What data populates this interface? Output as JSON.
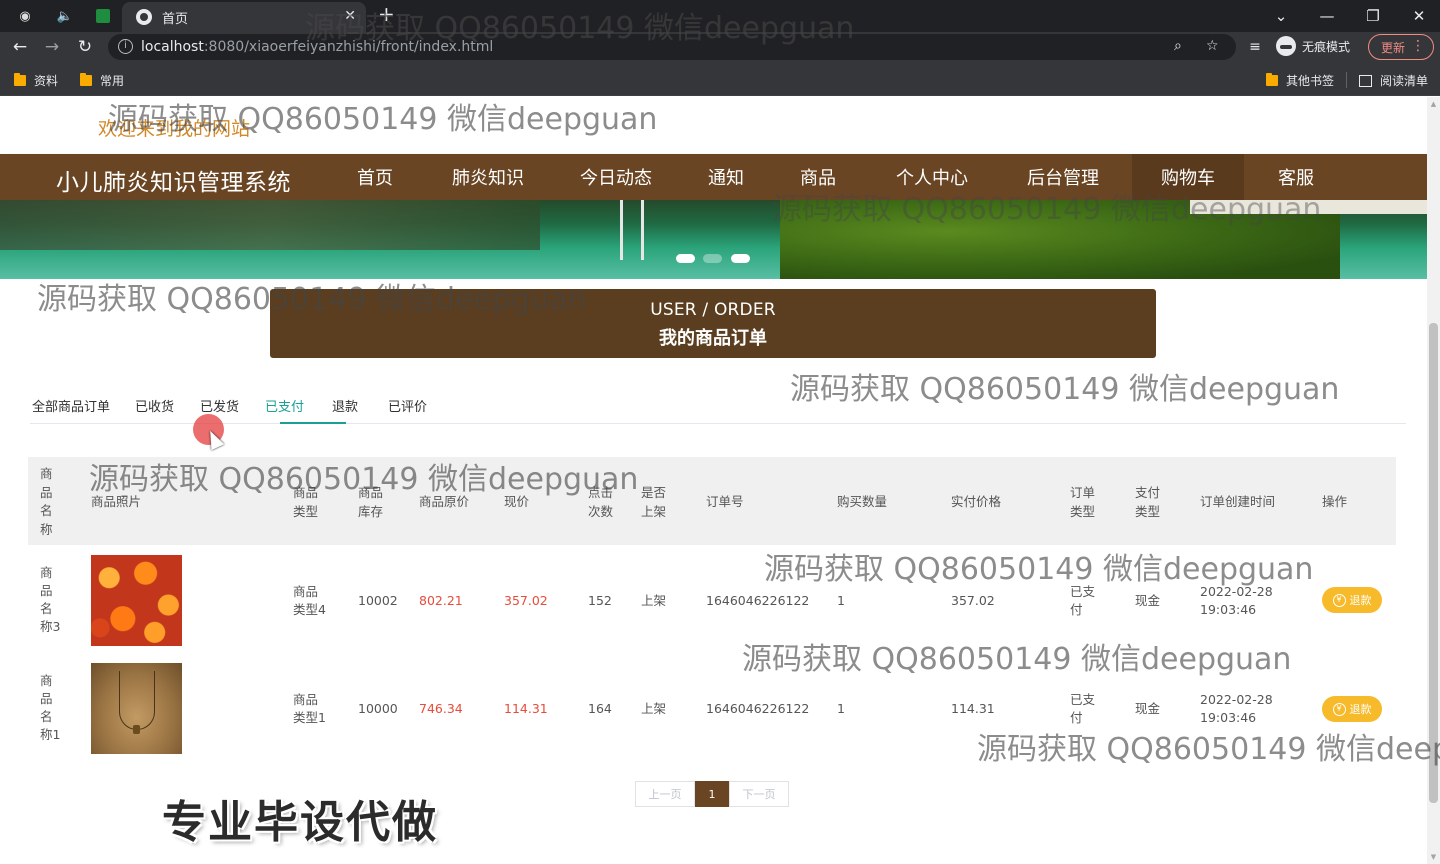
{
  "browser": {
    "tab_title": "首页",
    "url_host": "localhost",
    "url_path": ":8080/xiaoerfeiyanzhishi/front/index.html",
    "incognito_label": "无痕模式",
    "update_label": "更新",
    "bookmarks": [
      "资料",
      "常用"
    ],
    "bookmarks_right": [
      "其他书签",
      "阅读清单"
    ]
  },
  "site": {
    "welcome": "欢迎来到我的网站",
    "brand": "小儿肺炎知识管理系统",
    "nav": [
      "首页",
      "肺炎知识",
      "今日动态",
      "通知",
      "商品",
      "个人中心",
      "后台管理",
      "购物车",
      "客服"
    ],
    "active_nav": "购物车"
  },
  "order_banner": {
    "en": "USER / ORDER",
    "cn": "我的商品订单"
  },
  "order_tabs": {
    "items": [
      "全部商品订单",
      "已收货",
      "已发货",
      "已支付",
      "退款",
      "已评价"
    ],
    "active": "已支付"
  },
  "table": {
    "headers": {
      "name": "商\n品\n名\n称",
      "image": "商品照片",
      "type": "商品\n类型",
      "stock": "商品\n库存",
      "price": "商品原价",
      "current": "现价",
      "clicks": "点击\n次数",
      "onshelf": "是否\n上架",
      "order_no": "订单号",
      "qty": "购买数量",
      "paid": "实付价格",
      "order_type": "订单\n类型",
      "pay_type": "支付\n类型",
      "created": "订单创建时间",
      "action": "操作"
    },
    "rows": [
      {
        "name": "商\n品\n名\n称3",
        "image": "flowers",
        "type": "商品\n类型4",
        "stock": "10002",
        "price": "802.21",
        "current": "357.02",
        "clicks": "152",
        "onshelf": "上架",
        "order_no": "1646046226122",
        "qty": "1",
        "paid": "357.02",
        "order_type": "已支\n付",
        "pay_type": "现金",
        "created": "2022-02-28\n19:03:46",
        "action": "退款"
      },
      {
        "name": "商\n品\n名\n称1",
        "image": "necklace",
        "type": "商品\n类型1",
        "stock": "10000",
        "price": "746.34",
        "current": "114.31",
        "clicks": "164",
        "onshelf": "上架",
        "order_no": "1646046226122",
        "qty": "1",
        "paid": "114.31",
        "order_type": "已支\n付",
        "pay_type": "现金",
        "created": "2022-02-28\n19:03:46",
        "action": "退款"
      }
    ]
  },
  "pager": {
    "prev": "上一页",
    "current": "1",
    "next": "下一页"
  },
  "overlay": {
    "watermark": "源码获取 QQ86050149 微信deepguan",
    "watermark_cut": "源码获取 QQ86050149 微信deep",
    "promo": "专业毕设代做"
  },
  "colors": {
    "nav_bg": "#694523",
    "banner_bg": "#5b3d1f",
    "accent": "#1aa094",
    "price_red": "#e74c3c",
    "refund": "#f7ba2a"
  }
}
